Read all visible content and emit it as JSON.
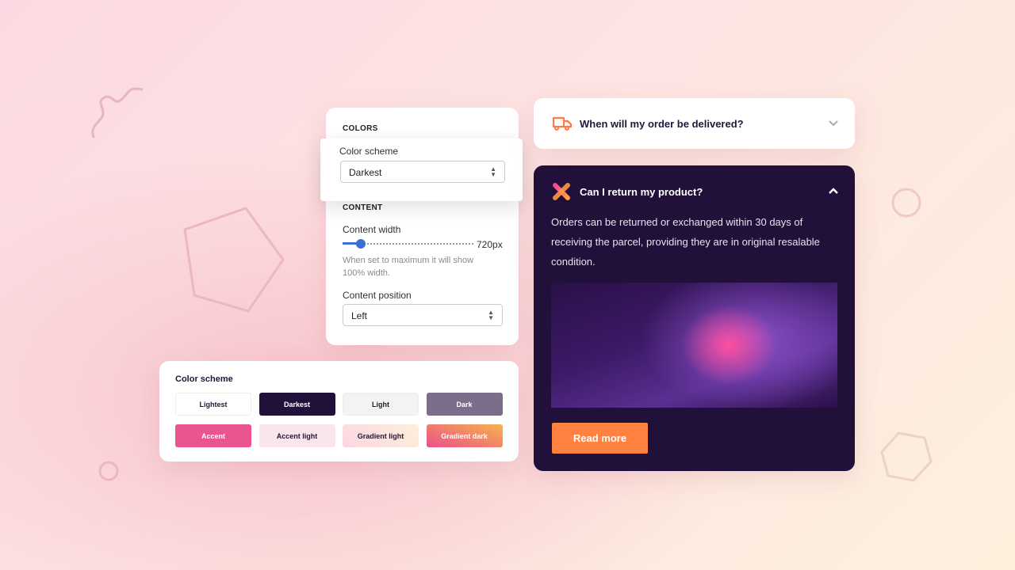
{
  "settings": {
    "colors_heading": "COLORS",
    "color_scheme_label": "Color scheme",
    "color_scheme_value": "Darkest",
    "content_heading": "CONTENT",
    "content_width_label": "Content width",
    "content_width_value": "720px",
    "content_width_fraction": 0.06,
    "content_width_help": "When set to maximum it will show 100% width.",
    "content_position_label": "Content position",
    "content_position_value": "Left"
  },
  "scheme": {
    "title": "Color scheme",
    "swatches": [
      {
        "label": "Lightest",
        "bg": "#ffffff"
      },
      {
        "label": "Darkest",
        "bg": "#20103a"
      },
      {
        "label": "Light",
        "bg": "#f3f3f3"
      },
      {
        "label": "Dark",
        "bg": "#7b6e8a"
      },
      {
        "label": "Accent",
        "bg": "#ea5590"
      },
      {
        "label": "Accent light",
        "bg": "#f9e6ec"
      },
      {
        "label": "Gradient light",
        "bg": "#fde4e6"
      },
      {
        "label": "Gradient dark",
        "bg": "#f07a5a"
      }
    ]
  },
  "faq": [
    {
      "question": "When will my order be delivered?",
      "icon": "truck-icon",
      "expanded": false
    },
    {
      "question": "Can I return my product?",
      "icon": "cross-logo-icon",
      "expanded": true,
      "answer": "Orders can be returned or exchanged within 30 days of receiving the parcel, providing they are in original resalable condition.",
      "button": "Read more"
    }
  ],
  "colors": {
    "accent": "#ff8240",
    "dark": "#20103a"
  }
}
